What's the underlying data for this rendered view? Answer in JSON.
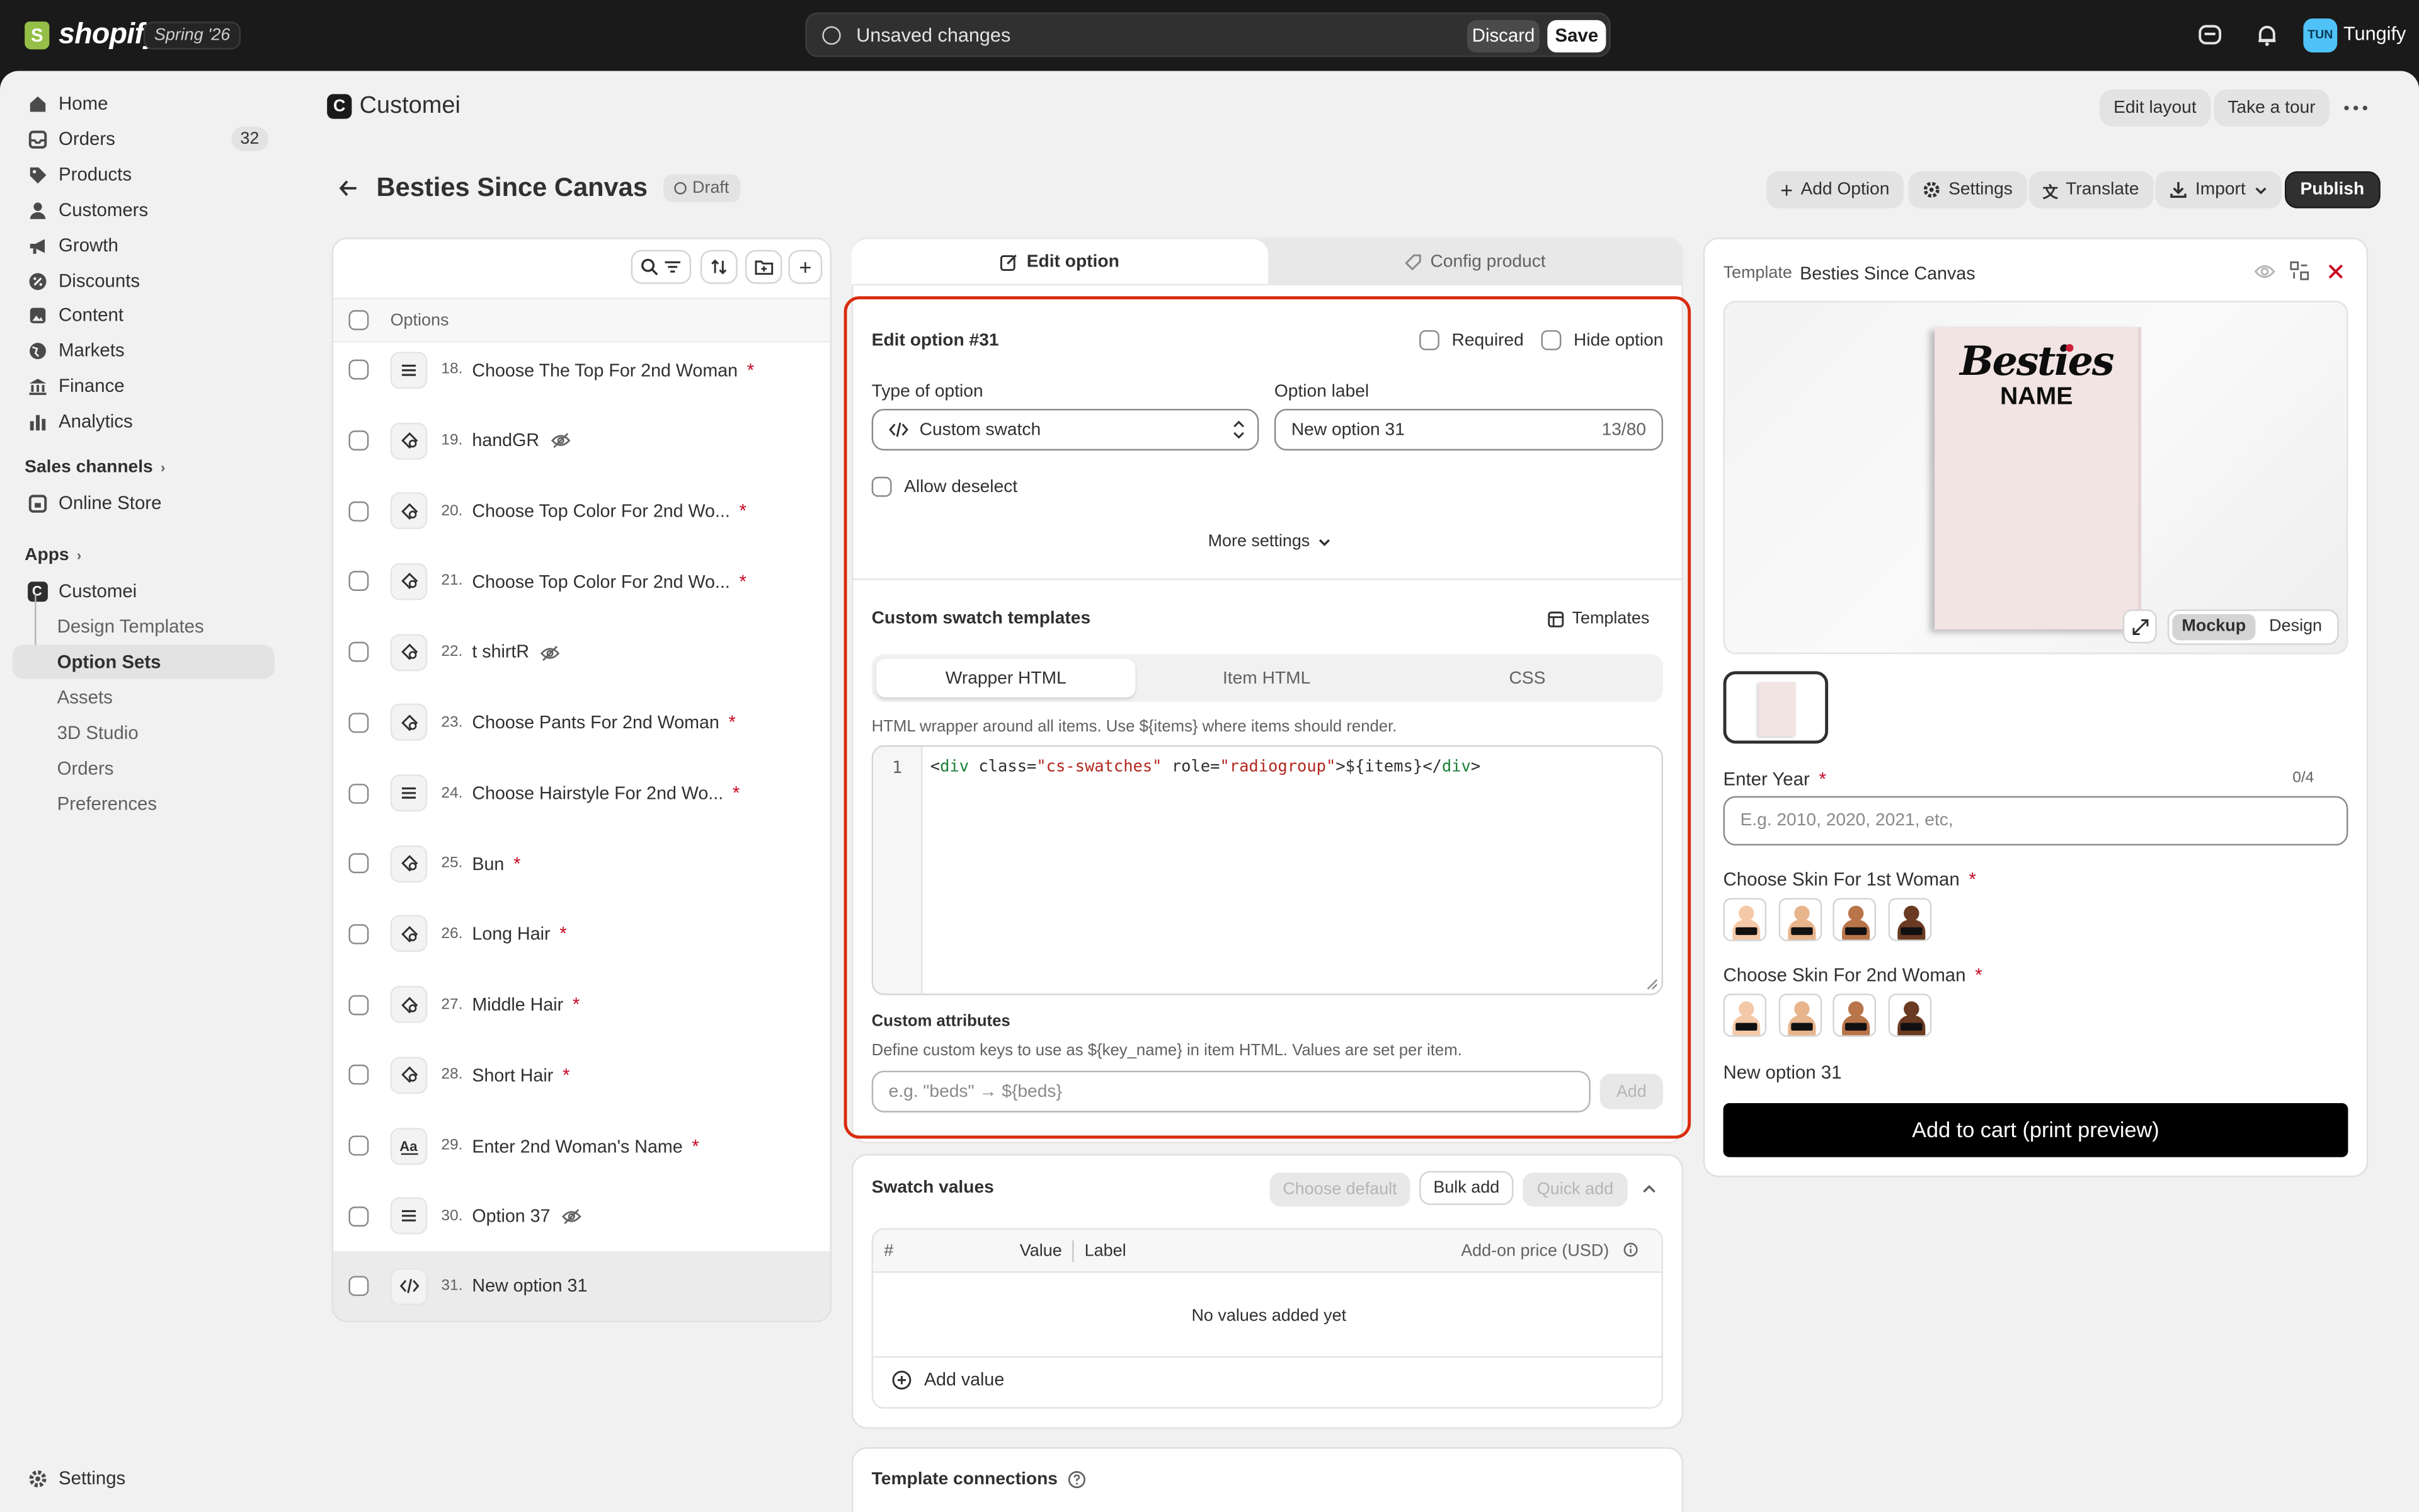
{
  "topbar": {
    "logo_text": "shopify",
    "badge": "Spring '26",
    "unsaved_text": "Unsaved changes",
    "discard_label": "Discard",
    "save_label": "Save",
    "avatar_initials": "TUN",
    "store_name": "Tungify"
  },
  "sidebar": {
    "items": [
      {
        "label": "Home",
        "icon": "home-icon"
      },
      {
        "label": "Orders",
        "icon": "inbox-icon",
        "count": "32"
      },
      {
        "label": "Products",
        "icon": "tag-icon"
      },
      {
        "label": "Customers",
        "icon": "person-icon"
      },
      {
        "label": "Growth",
        "icon": "megaphone-icon"
      },
      {
        "label": "Discounts",
        "icon": "discount-icon"
      },
      {
        "label": "Content",
        "icon": "content-icon"
      },
      {
        "label": "Markets",
        "icon": "globe-icon"
      },
      {
        "label": "Finance",
        "icon": "bank-icon"
      },
      {
        "label": "Analytics",
        "icon": "bar-chart-icon"
      }
    ],
    "sales_channels_heading": "Sales channels",
    "online_store": "Online Store",
    "apps_heading": "Apps",
    "app_name": "Customei",
    "app_sub_items": [
      "Design Templates",
      "Option Sets",
      "Assets",
      "3D Studio",
      "Orders",
      "Preferences"
    ],
    "settings_label": "Settings"
  },
  "header": {
    "app_title": "Customei",
    "edit_layout": "Edit layout",
    "take_tour": "Take a tour",
    "page_title": "Besties Since Canvas",
    "status": "Draft",
    "add_option": "Add Option",
    "settings": "Settings",
    "translate": "Translate",
    "import": "Import",
    "publish": "Publish"
  },
  "options_list": {
    "header": "Options",
    "rows": [
      {
        "num": "18.",
        "label": "Choose The Top For 2nd Woman",
        "required": true,
        "icon": "list-icon"
      },
      {
        "num": "19.",
        "label": "handGR",
        "hidden": true,
        "icon": "swatch-icon"
      },
      {
        "num": "20.",
        "label": "Choose Top Color For 2nd Wo...",
        "required": true,
        "icon": "swatch-icon"
      },
      {
        "num": "21.",
        "label": "Choose Top Color For 2nd Wo...",
        "required": true,
        "icon": "swatch-icon"
      },
      {
        "num": "22.",
        "label": "t shirtR",
        "hidden": true,
        "icon": "swatch-icon"
      },
      {
        "num": "23.",
        "label": "Choose Pants For 2nd Woman",
        "required": true,
        "icon": "swatch-icon"
      },
      {
        "num": "24.",
        "label": "Choose Hairstyle For 2nd Wo...",
        "required": true,
        "icon": "list-icon"
      },
      {
        "num": "25.",
        "label": "Bun",
        "required": true,
        "icon": "swatch-icon"
      },
      {
        "num": "26.",
        "label": "Long Hair",
        "required": true,
        "icon": "swatch-icon"
      },
      {
        "num": "27.",
        "label": "Middle Hair",
        "required": true,
        "icon": "swatch-icon"
      },
      {
        "num": "28.",
        "label": "Short Hair",
        "required": true,
        "icon": "swatch-icon"
      },
      {
        "num": "29.",
        "label": "Enter 2nd Woman's Name",
        "required": true,
        "icon": "text-icon"
      },
      {
        "num": "30.",
        "label": "Option 37",
        "hidden": true,
        "icon": "list-icon"
      },
      {
        "num": "31.",
        "label": "New option 31",
        "selected": true,
        "icon": "code-icon"
      }
    ]
  },
  "editor": {
    "tab_edit": "Edit option",
    "tab_config": "Config product",
    "title": "Edit option #31",
    "required_label": "Required",
    "hide_label": "Hide option",
    "type_label": "Type of option",
    "type_value": "Custom swatch",
    "option_label_label": "Option label",
    "option_label_value": "New option 31",
    "char_count": "13/80",
    "allow_deselect": "Allow deselect",
    "more_settings": "More settings",
    "swatch_templates_heading": "Custom swatch templates",
    "templates_btn": "Templates",
    "seg_tabs": [
      "Wrapper HTML",
      "Item HTML",
      "CSS"
    ],
    "wrapper_help": "HTML wrapper around all items. Use ${items} where items should render.",
    "code_line_number": "1",
    "code_parts": [
      "<",
      "div",
      " class=",
      "\"cs-swatches\"",
      " role=",
      "\"radiogroup\"",
      ">${items}</",
      "div",
      ">"
    ],
    "custom_attrs_heading": "Custom attributes",
    "custom_attrs_help": "Define custom keys to use as ${key_name} in item HTML. Values are set per item.",
    "custom_attrs_placeholder": "e.g. \"beds\" → ${beds}",
    "add_btn": "Add",
    "highlight_color": "#d82c0d"
  },
  "swatch_values": {
    "heading": "Swatch values",
    "choose_default": "Choose default",
    "bulk_add": "Bulk add",
    "quick_add": "Quick add",
    "columns": [
      "#",
      "Value",
      "Label",
      "Add-on price (USD)"
    ],
    "empty_text": "No values added yet",
    "add_value": "Add value"
  },
  "template_connections": {
    "heading": "Template connections"
  },
  "preview": {
    "template_label": "Template",
    "template_name": "Besties Since Canvas",
    "canvas_title": "Besties",
    "canvas_subtitle": "NAME",
    "mockup_btn": "Mockup",
    "design_btn": "Design",
    "year_label": "Enter Year",
    "year_count": "0/4",
    "year_placeholder": "E.g. 2010, 2020, 2021, etc,",
    "skin1_label": "Choose Skin For 1st Woman",
    "skin2_label": "Choose Skin For 2nd Woman",
    "skin_tones": [
      "#f4c9a8",
      "#e8b48c",
      "#b9744a",
      "#6a3a22"
    ],
    "new_option_label": "New option 31",
    "add_to_cart": "Add to cart (print preview)"
  }
}
